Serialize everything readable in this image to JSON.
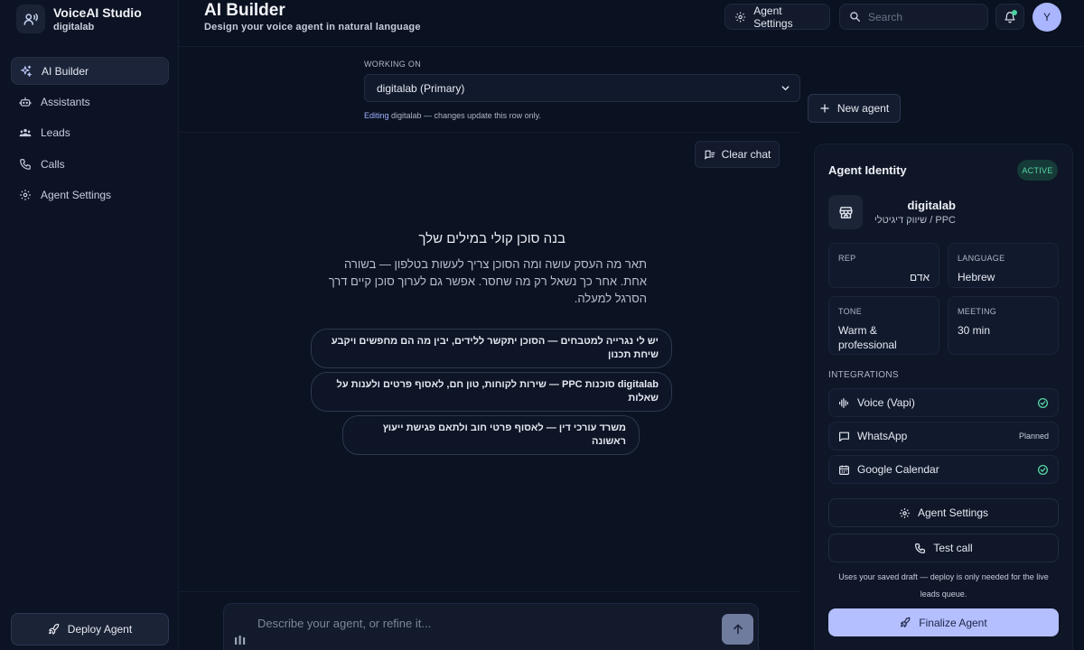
{
  "brand": {
    "title": "VoiceAI Studio",
    "subtitle": "digitalab"
  },
  "sidebar": {
    "items": [
      {
        "label": "AI Builder",
        "icon": "sparkle-icon",
        "active": true
      },
      {
        "label": "Assistants",
        "icon": "bot-icon"
      },
      {
        "label": "Leads",
        "icon": "users-icon"
      },
      {
        "label": "Calls",
        "icon": "phone-icon"
      },
      {
        "label": "Agent Settings",
        "icon": "gear-icon"
      }
    ],
    "deploy_label": "Deploy Agent"
  },
  "header": {
    "title": "AI Builder",
    "subtitle": "Design your voice agent in natural language",
    "settings_label": "Agent Settings",
    "search_placeholder": "Search",
    "avatar_initial": "Y"
  },
  "working_on": {
    "label": "WORKING ON",
    "selected": "digitalab (Primary)",
    "note_prefix": "Editing",
    "note_rest": " digitalab — changes update this row only.",
    "new_agent_label": "New agent"
  },
  "chat": {
    "clear_label": "Clear chat",
    "hero_title": "בנה סוכן קולי במילים שלך",
    "hero_desc": "תאר מה העסק עושה ומה הסוכן צריך לעשות בטלפון — בשורה אחת. אחר כך נשאל רק מה שחסר. אפשר גם לערוך סוכן קיים דרך הסרגל למעלה.",
    "suggestions": [
      "יש לי נגרייה למטבחים — הסוכן יתקשר ללידים, יבין מה הם מחפשים ויקבע שיחת תכנון",
      "digitalab סוכנות PPC — שירות לקוחות, טון חם, לאסוף פרטים ולענות על שאלות",
      "משרד עורכי דין — לאסוף פרטי חוב ולתאם פגישת ייעוץ ראשונה"
    ],
    "input_placeholder": "Describe your agent, or refine it..."
  },
  "identity": {
    "title": "Agent Identity",
    "status": "ACTIVE",
    "name": "digitalab",
    "category": "שיווק דיגיטלי / PPC",
    "fields": {
      "rep_label": "REP",
      "rep_value": "אדם",
      "language_label": "LANGUAGE",
      "language_value": "Hebrew",
      "tone_label": "TONE",
      "tone_value": "Warm & professional",
      "meeting_label": "MEETING",
      "meeting_value": "30 min"
    },
    "integrations_label": "INTEGRATIONS",
    "integrations": [
      {
        "label": "Voice (Vapi)",
        "status": "connected"
      },
      {
        "label": "WhatsApp",
        "status": "Planned"
      },
      {
        "label": "Google Calendar",
        "status": "connected"
      }
    ],
    "settings_label": "Agent Settings",
    "test_call_label": "Test call",
    "draft_note": "Uses your saved draft — deploy is only needed for the live leads queue.",
    "finalize_label": "Finalize Agent"
  },
  "colors": {
    "background": "#0a1120",
    "accent": "#b4bfff",
    "success": "#57d6a4"
  }
}
